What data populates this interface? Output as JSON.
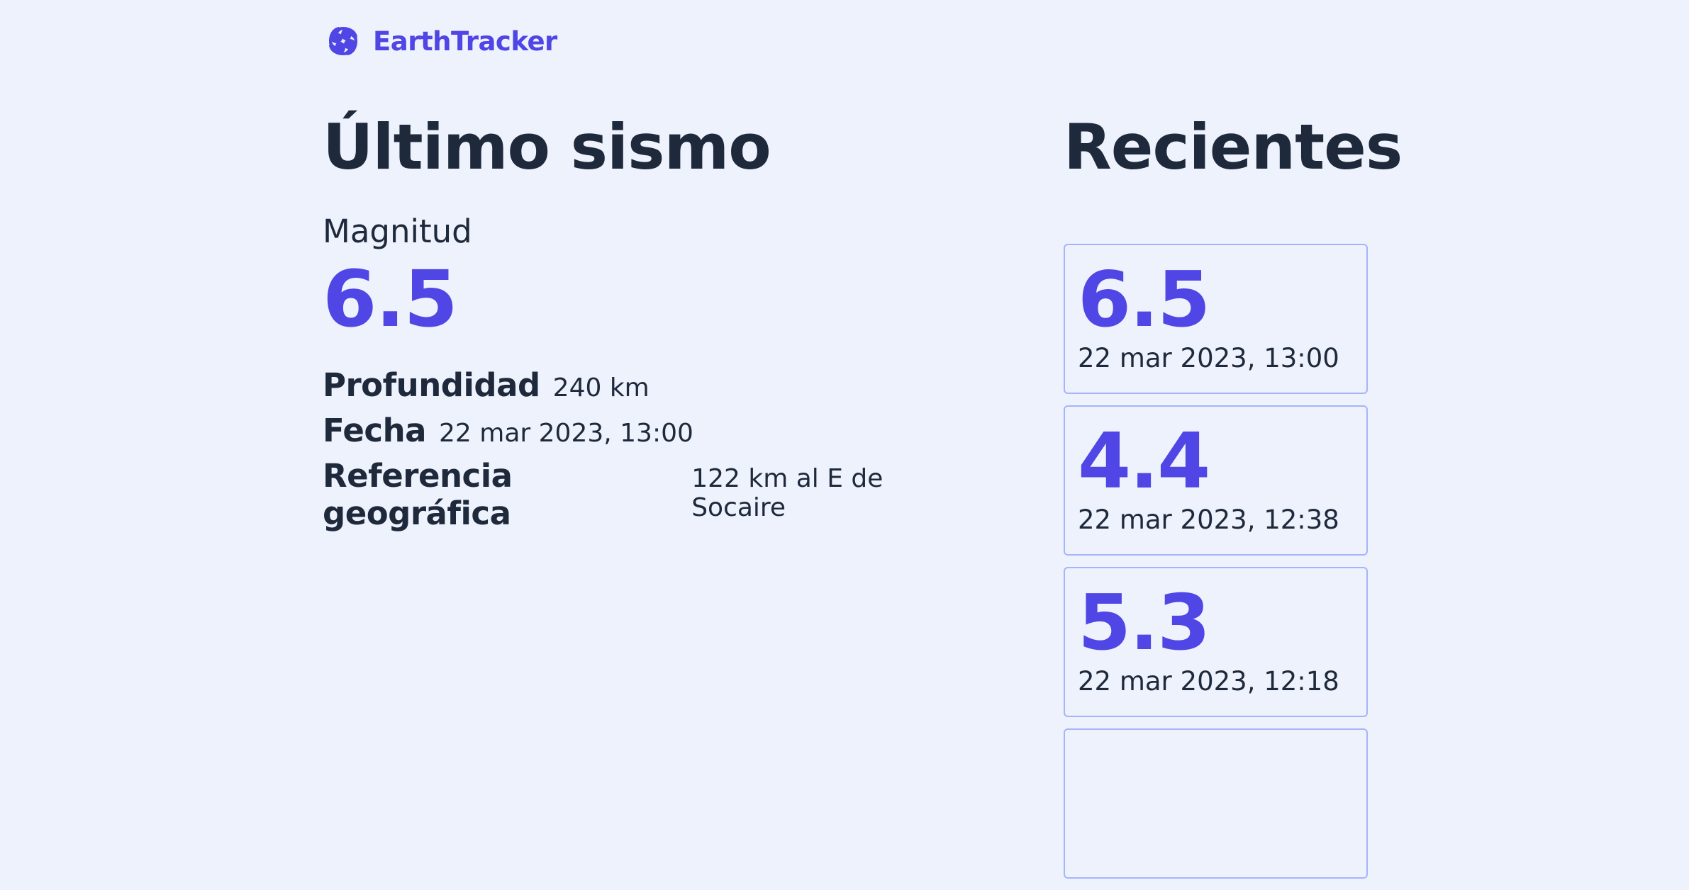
{
  "brand": {
    "name": "EarthTracker",
    "icon": "spiral-logo-icon",
    "color": "#4f46e5"
  },
  "latest": {
    "title": "Último sismo",
    "magnitude_label": "Magnitud",
    "magnitude": "6.5",
    "details": [
      {
        "key": "Profundidad",
        "value": "240 km"
      },
      {
        "key": "Fecha",
        "value": "22 mar 2023, 13:00"
      },
      {
        "key": "Referencia geográfica",
        "value": "122 km al E de Socaire"
      }
    ]
  },
  "recent": {
    "title": "Recientes",
    "items": [
      {
        "magnitude": "6.5",
        "date": "22 mar 2023, 13:00"
      },
      {
        "magnitude": "4.4",
        "date": "22 mar 2023, 12:38"
      },
      {
        "magnitude": "5.3",
        "date": "22 mar 2023, 12:18"
      },
      {
        "magnitude": "",
        "date": ""
      }
    ]
  },
  "colors": {
    "background": "#eef2fc",
    "accent": "#4f46e5",
    "text": "#1e293b",
    "card_border": "#a5b4fc"
  }
}
